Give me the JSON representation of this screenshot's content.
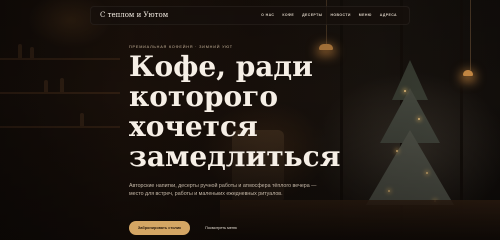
{
  "brand": {
    "name": "С теплом и Уютом"
  },
  "nav": {
    "items": [
      {
        "label": "О НАС"
      },
      {
        "label": "КОФЕ"
      },
      {
        "label": "ДЕСЕРТЫ"
      },
      {
        "label": "НОВОСТИ"
      },
      {
        "label": "МЕНЮ"
      },
      {
        "label": "АДРЕСА"
      }
    ]
  },
  "hero": {
    "eyebrow": "ПРЕМИАЛЬНАЯ КОФЕЙНЯ · ЗИМНИЙ УЮТ",
    "headline_lines": [
      "Кофе, ради",
      "которого",
      "хочется",
      "замедлиться"
    ],
    "subtitle": "Авторские напитки, десерты ручной работы и атмосфера тёплого вечера — место для встреч, работы и маленьких ежедневных ритуалов.",
    "primary_cta": "Забронировать столик",
    "secondary_cta": "Посмотреть меню"
  },
  "colors": {
    "accent": "#d4a664",
    "background": "#0f0a07",
    "text": "#f6efe6"
  }
}
